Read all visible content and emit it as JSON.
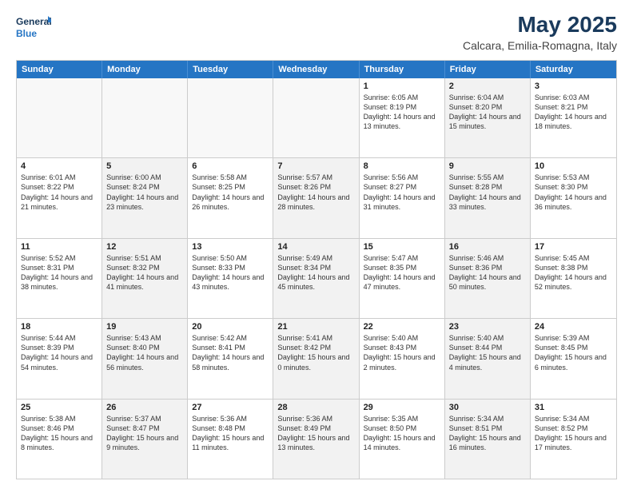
{
  "header": {
    "logo_line1": "General",
    "logo_line2": "Blue",
    "main_title": "May 2025",
    "sub_title": "Calcara, Emilia-Romagna, Italy"
  },
  "days_of_week": [
    "Sunday",
    "Monday",
    "Tuesday",
    "Wednesday",
    "Thursday",
    "Friday",
    "Saturday"
  ],
  "rows": [
    {
      "cells": [
        {
          "day": "",
          "text": "",
          "empty": true
        },
        {
          "day": "",
          "text": "",
          "empty": true
        },
        {
          "day": "",
          "text": "",
          "empty": true
        },
        {
          "day": "",
          "text": "",
          "empty": true
        },
        {
          "day": "1",
          "text": "Sunrise: 6:05 AM\nSunset: 8:19 PM\nDaylight: 14 hours\nand 13 minutes."
        },
        {
          "day": "2",
          "text": "Sunrise: 6:04 AM\nSunset: 8:20 PM\nDaylight: 14 hours\nand 15 minutes.",
          "shaded": true
        },
        {
          "day": "3",
          "text": "Sunrise: 6:03 AM\nSunset: 8:21 PM\nDaylight: 14 hours\nand 18 minutes."
        }
      ]
    },
    {
      "cells": [
        {
          "day": "4",
          "text": "Sunrise: 6:01 AM\nSunset: 8:22 PM\nDaylight: 14 hours\nand 21 minutes."
        },
        {
          "day": "5",
          "text": "Sunrise: 6:00 AM\nSunset: 8:24 PM\nDaylight: 14 hours\nand 23 minutes.",
          "shaded": true
        },
        {
          "day": "6",
          "text": "Sunrise: 5:58 AM\nSunset: 8:25 PM\nDaylight: 14 hours\nand 26 minutes."
        },
        {
          "day": "7",
          "text": "Sunrise: 5:57 AM\nSunset: 8:26 PM\nDaylight: 14 hours\nand 28 minutes.",
          "shaded": true
        },
        {
          "day": "8",
          "text": "Sunrise: 5:56 AM\nSunset: 8:27 PM\nDaylight: 14 hours\nand 31 minutes."
        },
        {
          "day": "9",
          "text": "Sunrise: 5:55 AM\nSunset: 8:28 PM\nDaylight: 14 hours\nand 33 minutes.",
          "shaded": true
        },
        {
          "day": "10",
          "text": "Sunrise: 5:53 AM\nSunset: 8:30 PM\nDaylight: 14 hours\nand 36 minutes."
        }
      ]
    },
    {
      "cells": [
        {
          "day": "11",
          "text": "Sunrise: 5:52 AM\nSunset: 8:31 PM\nDaylight: 14 hours\nand 38 minutes."
        },
        {
          "day": "12",
          "text": "Sunrise: 5:51 AM\nSunset: 8:32 PM\nDaylight: 14 hours\nand 41 minutes.",
          "shaded": true
        },
        {
          "day": "13",
          "text": "Sunrise: 5:50 AM\nSunset: 8:33 PM\nDaylight: 14 hours\nand 43 minutes."
        },
        {
          "day": "14",
          "text": "Sunrise: 5:49 AM\nSunset: 8:34 PM\nDaylight: 14 hours\nand 45 minutes.",
          "shaded": true
        },
        {
          "day": "15",
          "text": "Sunrise: 5:47 AM\nSunset: 8:35 PM\nDaylight: 14 hours\nand 47 minutes."
        },
        {
          "day": "16",
          "text": "Sunrise: 5:46 AM\nSunset: 8:36 PM\nDaylight: 14 hours\nand 50 minutes.",
          "shaded": true
        },
        {
          "day": "17",
          "text": "Sunrise: 5:45 AM\nSunset: 8:38 PM\nDaylight: 14 hours\nand 52 minutes."
        }
      ]
    },
    {
      "cells": [
        {
          "day": "18",
          "text": "Sunrise: 5:44 AM\nSunset: 8:39 PM\nDaylight: 14 hours\nand 54 minutes."
        },
        {
          "day": "19",
          "text": "Sunrise: 5:43 AM\nSunset: 8:40 PM\nDaylight: 14 hours\nand 56 minutes.",
          "shaded": true
        },
        {
          "day": "20",
          "text": "Sunrise: 5:42 AM\nSunset: 8:41 PM\nDaylight: 14 hours\nand 58 minutes."
        },
        {
          "day": "21",
          "text": "Sunrise: 5:41 AM\nSunset: 8:42 PM\nDaylight: 15 hours\nand 0 minutes.",
          "shaded": true
        },
        {
          "day": "22",
          "text": "Sunrise: 5:40 AM\nSunset: 8:43 PM\nDaylight: 15 hours\nand 2 minutes."
        },
        {
          "day": "23",
          "text": "Sunrise: 5:40 AM\nSunset: 8:44 PM\nDaylight: 15 hours\nand 4 minutes.",
          "shaded": true
        },
        {
          "day": "24",
          "text": "Sunrise: 5:39 AM\nSunset: 8:45 PM\nDaylight: 15 hours\nand 6 minutes."
        }
      ]
    },
    {
      "cells": [
        {
          "day": "25",
          "text": "Sunrise: 5:38 AM\nSunset: 8:46 PM\nDaylight: 15 hours\nand 8 minutes."
        },
        {
          "day": "26",
          "text": "Sunrise: 5:37 AM\nSunset: 8:47 PM\nDaylight: 15 hours\nand 9 minutes.",
          "shaded": true
        },
        {
          "day": "27",
          "text": "Sunrise: 5:36 AM\nSunset: 8:48 PM\nDaylight: 15 hours\nand 11 minutes."
        },
        {
          "day": "28",
          "text": "Sunrise: 5:36 AM\nSunset: 8:49 PM\nDaylight: 15 hours\nand 13 minutes.",
          "shaded": true
        },
        {
          "day": "29",
          "text": "Sunrise: 5:35 AM\nSunset: 8:50 PM\nDaylight: 15 hours\nand 14 minutes."
        },
        {
          "day": "30",
          "text": "Sunrise: 5:34 AM\nSunset: 8:51 PM\nDaylight: 15 hours\nand 16 minutes.",
          "shaded": true
        },
        {
          "day": "31",
          "text": "Sunrise: 5:34 AM\nSunset: 8:52 PM\nDaylight: 15 hours\nand 17 minutes."
        }
      ]
    }
  ]
}
